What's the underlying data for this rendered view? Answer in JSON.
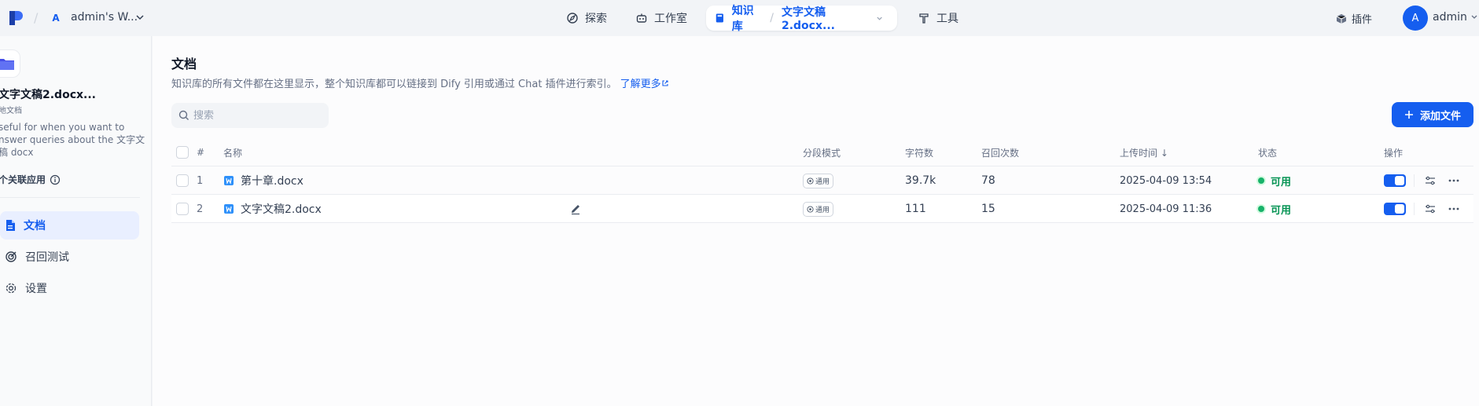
{
  "header": {
    "workspace_badge": "A",
    "workspace_name": "admin's W...",
    "nav": {
      "explore": "探索",
      "studio": "工作室",
      "knowledge": "知识库",
      "current_dataset": "文字文稿2.docx...",
      "tools": "工具"
    },
    "plugins": "插件",
    "avatar_letter": "A",
    "user_name": "admin"
  },
  "sidebar": {
    "dataset_title": "文字文稿2.docx...",
    "dataset_source": "地文档",
    "dataset_description": "seful for when you want to nswer queries about the 文字文稿 docx",
    "linked_apps": "个关联应用",
    "items": [
      {
        "label": "文档"
      },
      {
        "label": "召回测试"
      },
      {
        "label": "设置"
      }
    ]
  },
  "main": {
    "title": "文档",
    "description": "知识库的所有文件都在这里显示，整个知识库都可以链接到 Dify 引用或通过 Chat 插件进行索引。",
    "learn_more": "了解更多",
    "search_placeholder": "搜索",
    "add_file": "添加文件",
    "columns": {
      "num": "#",
      "name": "名称",
      "mode": "分段模式",
      "chars": "字符数",
      "recall": "召回次数",
      "upload_time": "上传时间 ↓",
      "status": "状态",
      "ops": "操作"
    },
    "rows": [
      {
        "num": "1",
        "name": "第十章.docx",
        "mode": "通用",
        "chars": "39.7k",
        "recall": "78",
        "upload_time": "2025-04-09 13:54",
        "status": "可用"
      },
      {
        "num": "2",
        "name": "文字文稿2.docx",
        "mode": "通用",
        "chars": "111",
        "recall": "15",
        "upload_time": "2025-04-09 11:36",
        "status": "可用"
      }
    ]
  },
  "colors": {
    "accent": "#155eef",
    "status_green": "#079455"
  }
}
